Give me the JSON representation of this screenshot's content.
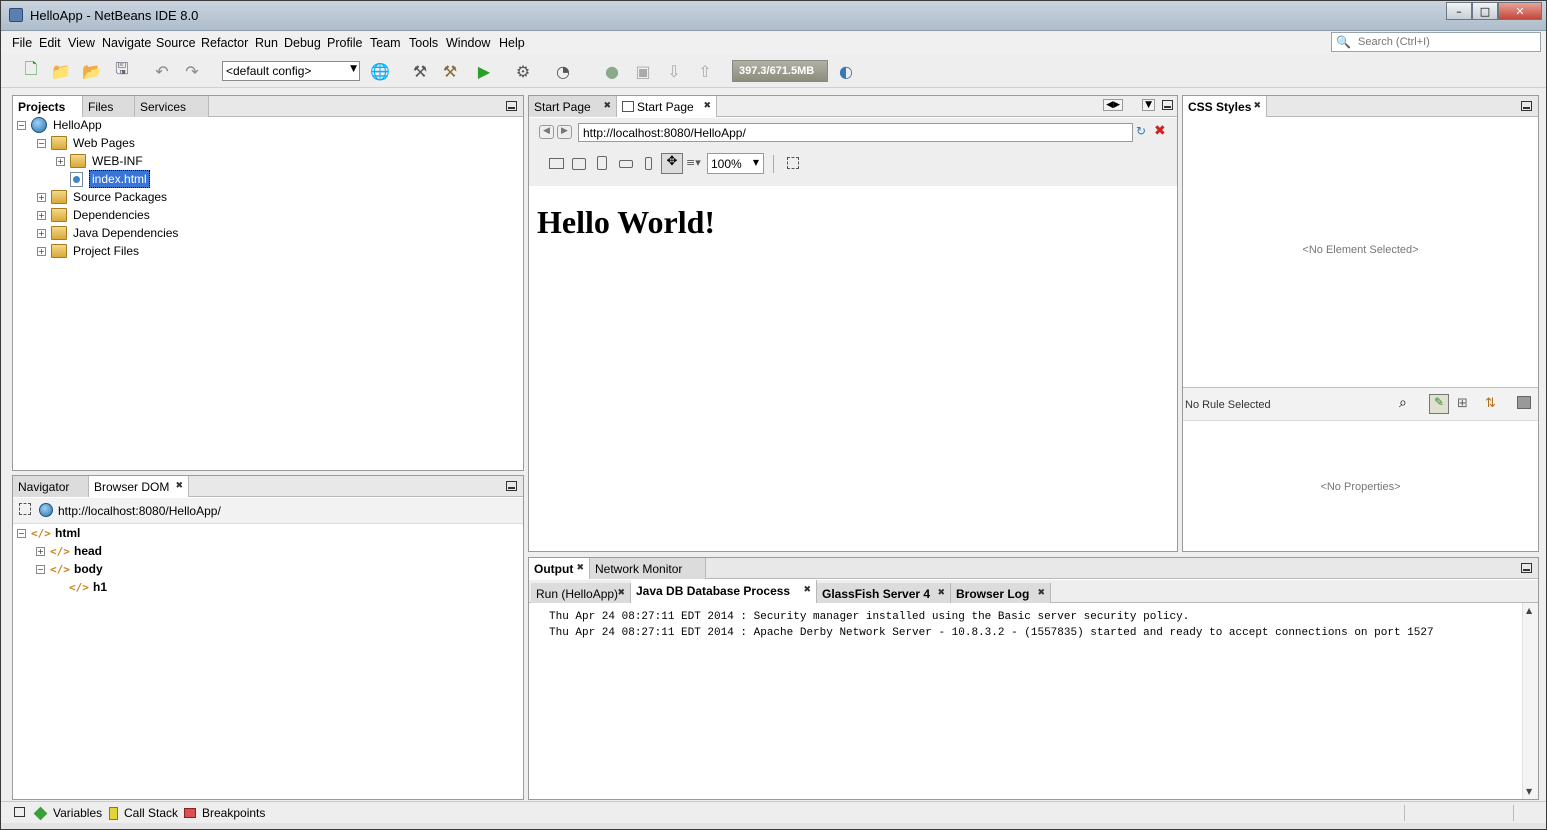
{
  "window": {
    "title": "HelloApp - NetBeans IDE 8.0"
  },
  "menu": [
    "File",
    "Edit",
    "View",
    "Navigate",
    "Source",
    "Refactor",
    "Run",
    "Debug",
    "Profile",
    "Team",
    "Tools",
    "Window",
    "Help"
  ],
  "search": {
    "placeholder": "Search (Ctrl+I)"
  },
  "toolbar": {
    "config": "<default config>",
    "memory": "397.3/671.5MB"
  },
  "projects_panel": {
    "tabs": [
      "Projects",
      "Files",
      "Services"
    ],
    "tree": {
      "root": "HelloApp",
      "web_pages": "Web Pages",
      "web_inf": "WEB-INF",
      "index": "index.html",
      "source_packages": "Source Packages",
      "dependencies": "Dependencies",
      "java_dependencies": "Java Dependencies",
      "project_files": "Project Files"
    }
  },
  "navigator_panel": {
    "tabs": [
      "Navigator",
      "Browser DOM"
    ],
    "url": "http://localhost:8080/HelloApp/",
    "dom": {
      "html": "html",
      "head": "head",
      "body": "body",
      "h1": "h1"
    }
  },
  "editor": {
    "tabs": [
      "Start Page",
      "Start Page"
    ],
    "url": "http://localhost:8080/HelloApp/",
    "zoom": "100%",
    "heading": "Hello World!"
  },
  "css_panel": {
    "tab": "CSS Styles",
    "no_element": "<No Element Selected>",
    "no_rule": "No Rule Selected",
    "no_properties": "<No Properties>"
  },
  "output_panel": {
    "tabs": [
      "Output",
      "Network Monitor"
    ],
    "subtabs": [
      "Run (HelloApp)",
      "Java DB Database Process",
      "GlassFish Server 4",
      "Browser Log"
    ],
    "lines": [
      "Thu Apr 24 08:27:11 EDT 2014 : Security manager installed using the Basic server security policy.",
      "Thu Apr 24 08:27:11 EDT 2014 : Apache Derby Network Server - 10.8.3.2 - (1557835) started and ready to accept connections on port 1527"
    ]
  },
  "bottom_tabs": [
    "Variables",
    "Call Stack",
    "Breakpoints"
  ]
}
